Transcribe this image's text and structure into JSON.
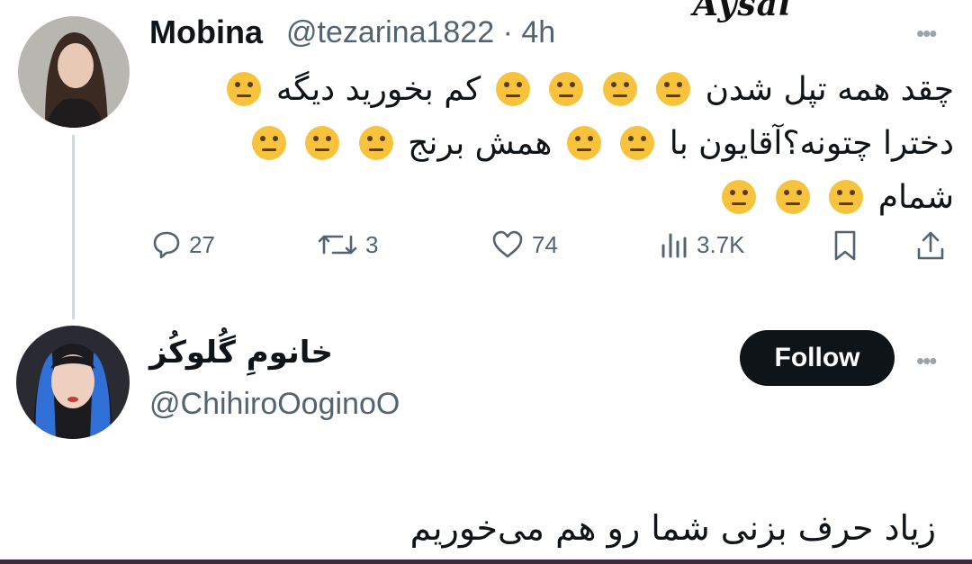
{
  "watermark": "Aysal",
  "tweet": {
    "author_name": "Mobina",
    "author_handle": "@tezarina1822",
    "time": "· 4h",
    "line1_text": "چقد همه تپل شدن",
    "line1_text2": "کم بخورید دیگه",
    "line2_text": "همش برنج",
    "line2_text2": "دخترا چتونه؟آقایون با",
    "line3_text": "شمام",
    "emoji_name": "neutral-face-emoji",
    "actions": {
      "replies": "27",
      "retweets": "3",
      "likes": "74",
      "views": "3.7K"
    }
  },
  "reply": {
    "author_name": "خانومِ گُلوکُز",
    "author_handle": "@ChihiroOoginoO",
    "follow_label": "Follow",
    "text": "زیاد حرف بزنی شما رو هم می‌خوریم"
  },
  "colors": {
    "text": "#0f1419",
    "secondary": "#536471",
    "thread_line": "#cfd9de",
    "emoji_yellow": "#f7c23c",
    "follow_bg": "#0f1419"
  }
}
